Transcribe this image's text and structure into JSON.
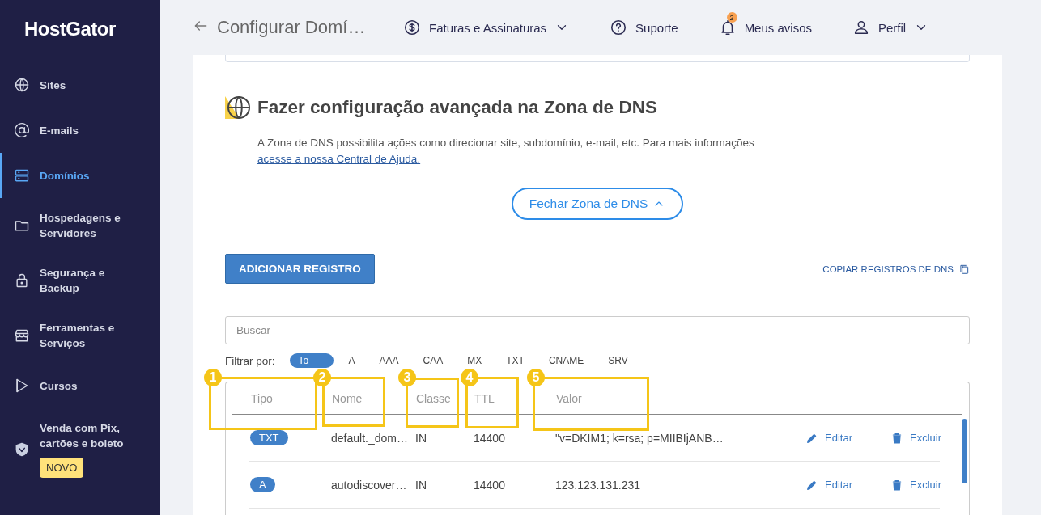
{
  "sidebar": {
    "logo": "HostGator",
    "items": [
      {
        "label": "Sites",
        "selected": false
      },
      {
        "label": "E-mails",
        "selected": false
      },
      {
        "label": "Domínios",
        "selected": true
      },
      {
        "label": "Hospedagens e Servidores",
        "selected": false
      },
      {
        "label": "Segurança e Backup",
        "selected": false
      },
      {
        "label": "Ferramentas e Serviços",
        "selected": false
      },
      {
        "label": "Cursos",
        "selected": false
      },
      {
        "label": "Venda com Pix, cartões e boleto",
        "selected": false,
        "badge": "NOVO"
      }
    ]
  },
  "header": {
    "title": "Configurar Domí…",
    "nav": [
      {
        "label": "Faturas e Assinaturas",
        "dropdown": true
      },
      {
        "label": "Suporte",
        "dropdown": false
      },
      {
        "label": "Meus avisos",
        "dropdown": false,
        "count": "2"
      },
      {
        "label": "Perfil",
        "dropdown": true
      }
    ]
  },
  "dns_section": {
    "title": "Fazer configuração avançada na Zona de DNS",
    "description": "A Zona de DNS possibilita ações como direcionar site, subdomínio, e-mail, etc. Para mais informações",
    "link": "acesse a nossa Central de Ajuda.",
    "toggle_button": "Fechar Zona de DNS",
    "add_button": "ADICIONAR REGISTRO",
    "copy_link": "COPIAR REGISTROS DE DNS",
    "search": {
      "placeholder": "Buscar"
    },
    "filter_label": "Filtrar por:",
    "filters": [
      {
        "label": "To",
        "selected": true
      },
      {
        "label": "A",
        "selected": false
      },
      {
        "label": "AAA",
        "selected": false
      },
      {
        "label": "CAA",
        "selected": false
      },
      {
        "label": "MX",
        "selected": false
      },
      {
        "label": "TXT",
        "selected": false
      },
      {
        "label": "CNAME",
        "selected": false
      },
      {
        "label": "SRV",
        "selected": false
      }
    ],
    "table": {
      "columns": [
        "Tipo",
        "Nome",
        "Classe",
        "TTL",
        "Valor"
      ],
      "rows": [
        {
          "type": "TXT",
          "name": "default._dom…",
          "class": "IN",
          "ttl": "14400",
          "value": "\"v=DKIM1; k=rsa; p=MIIBIjANB…",
          "edit": "Editar",
          "delete": "Excluir"
        },
        {
          "type": "A",
          "name": "autodiscover…",
          "class": "IN",
          "ttl": "14400",
          "value": "123.123.131.231",
          "edit": "Editar",
          "delete": "Excluir"
        }
      ]
    }
  },
  "annotations": [
    {
      "number": "1"
    },
    {
      "number": "2"
    },
    {
      "number": "3"
    },
    {
      "number": "4"
    },
    {
      "number": "5"
    }
  ]
}
